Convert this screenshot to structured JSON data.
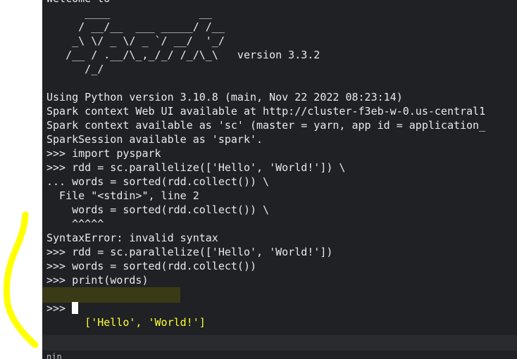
{
  "terminal": {
    "lines": [
      "Welcome to",
      "      ____              __",
      "     / __/__  ___ _____/ /__",
      "    _\\ \\/ _ \\/ _ `/ __/  '_/",
      "   /__ / .__/\\_,_/_/ /_/\\_\\   version 3.3.2",
      "      /_/",
      "",
      "Using Python version 3.10.8 (main, Nov 22 2022 08:23:14)",
      "Spark context Web UI available at http://cluster-f3eb-w-0.us-central1",
      "Spark context available as 'sc' (master = yarn, app id = application_",
      "SparkSession available as 'spark'.",
      ">>> import pyspark",
      ">>> rdd = sc.parallelize(['Hello', 'World!']) \\",
      "... words = sorted(rdd.collect()) \\",
      "  File \"<stdin>\", line 2",
      "    words = sorted(rdd.collect()) \\",
      "    ^^^^^",
      "SyntaxError: invalid syntax",
      ">>> rdd = sc.parallelize(['Hello', 'World!'])",
      ">>> words = sorted(rdd.collect())",
      ">>> print(words)"
    ],
    "output_line": "['Hello', 'World!']",
    "prompt": ">>> "
  },
  "bottom_strip": {
    "text": "nin"
  },
  "colors": {
    "terminal_bg": "#202124",
    "text": "#e8eaed",
    "highlight": "#ffff33",
    "annotation": "#ffff00"
  }
}
